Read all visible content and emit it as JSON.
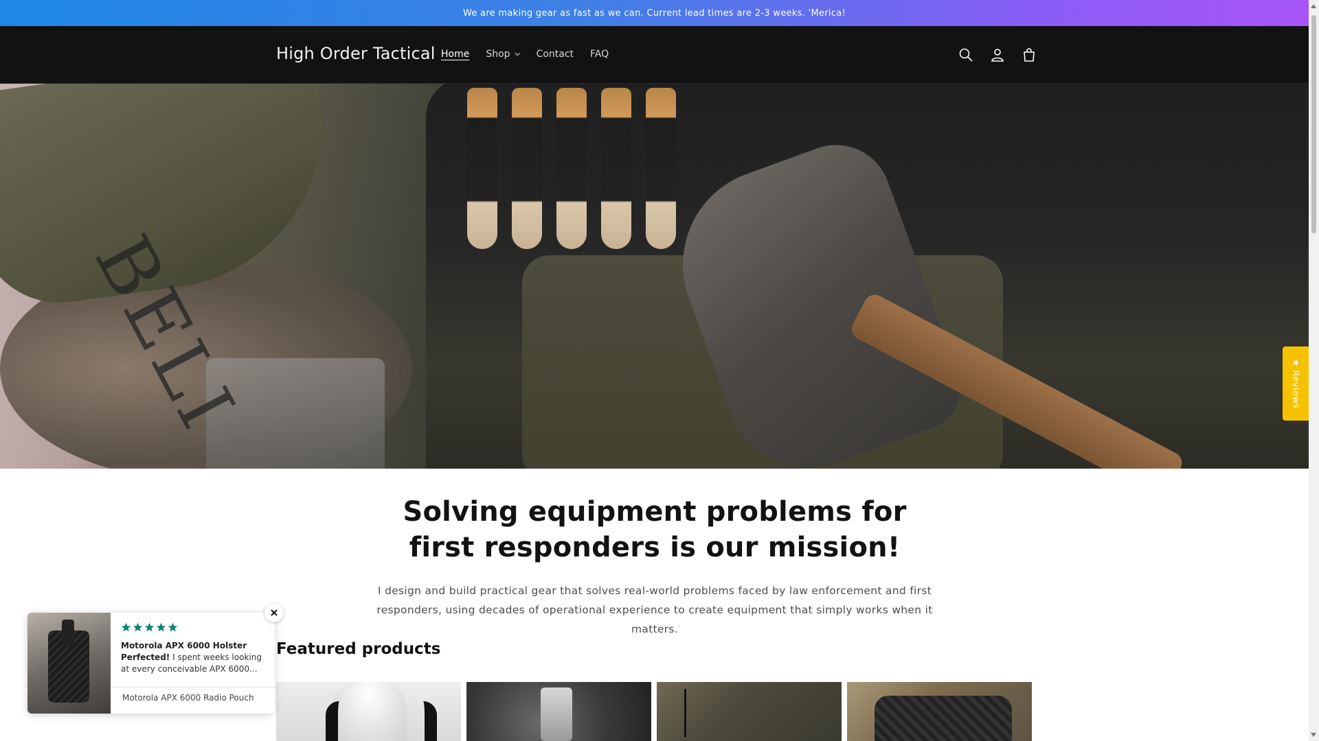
{
  "announcement": {
    "text": "We are making gear as fast as we can. Current lead times are 2-3 weeks. 'Merica!"
  },
  "header": {
    "logo": "High Order Tactical",
    "nav": [
      {
        "label": "Home",
        "active": true
      },
      {
        "label": "Shop",
        "has_dropdown": true
      },
      {
        "label": "Contact"
      },
      {
        "label": "FAQ"
      }
    ],
    "icons": [
      "search-icon",
      "account-icon",
      "cart-icon"
    ]
  },
  "hero": {
    "tattoo_text": "BELI"
  },
  "main": {
    "headline": "Solving equipment problems for first responders is our mission!",
    "subtext": "I design and build practical gear that solves real-world problems faced by law enforcement and first responders, using decades of operational experience to create equipment that simply works when it matters.",
    "featured_title": "Featured products"
  },
  "review_popup": {
    "rating": 5,
    "title": "Motorola APX 6000 Holster Perfected!",
    "excerpt": "I spent weeks looking at every conceivable APX 6000...",
    "product": "Motorola APX 6000 Radio Pouch",
    "star_color": "#108474"
  },
  "reviews_tab": {
    "label": "★ Reviews",
    "color": "#f6c200"
  }
}
